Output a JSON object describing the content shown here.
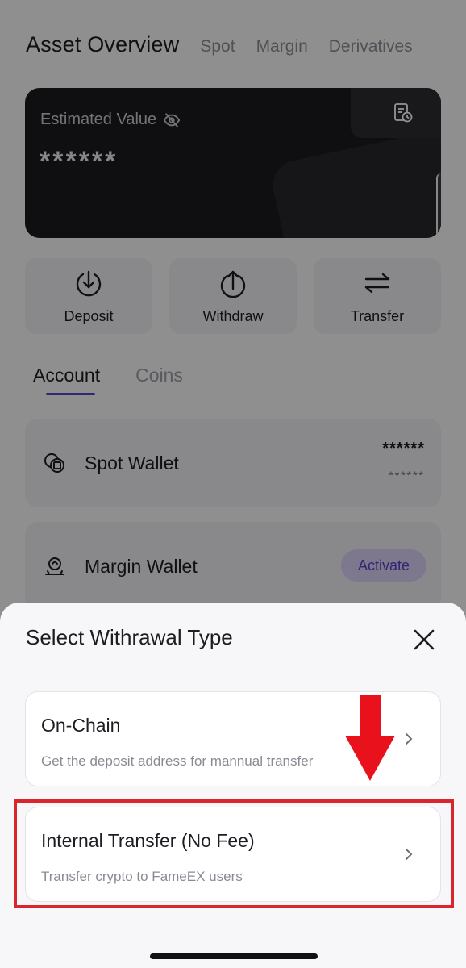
{
  "header": {
    "title": "Asset Overview",
    "tabs": [
      "Spot",
      "Margin",
      "Derivatives"
    ]
  },
  "card": {
    "estimated_label": "Estimated Value",
    "estimated_value": "******"
  },
  "actions": [
    {
      "label": "Deposit",
      "icon": "deposit-icon"
    },
    {
      "label": "Withdraw",
      "icon": "withdraw-icon"
    },
    {
      "label": "Transfer",
      "icon": "transfer-icon"
    }
  ],
  "account_tabs": {
    "active": "Account",
    "inactive": "Coins"
  },
  "wallets": {
    "spot": {
      "name": "Spot Wallet",
      "amount": "******",
      "amount_secondary": "******"
    },
    "margin": {
      "name": "Margin Wallet",
      "action": "Activate"
    }
  },
  "sheet": {
    "title": "Select Withrawal Type",
    "options": [
      {
        "title": "On-Chain",
        "desc": "Get the deposit address for mannual transfer"
      },
      {
        "title": "Internal Transfer (No Fee)",
        "desc": "Transfer crypto to FameEX users"
      }
    ]
  },
  "colors": {
    "accent": "#5b3fc4",
    "highlight": "#d8262c",
    "arrow": "#e8111c"
  }
}
